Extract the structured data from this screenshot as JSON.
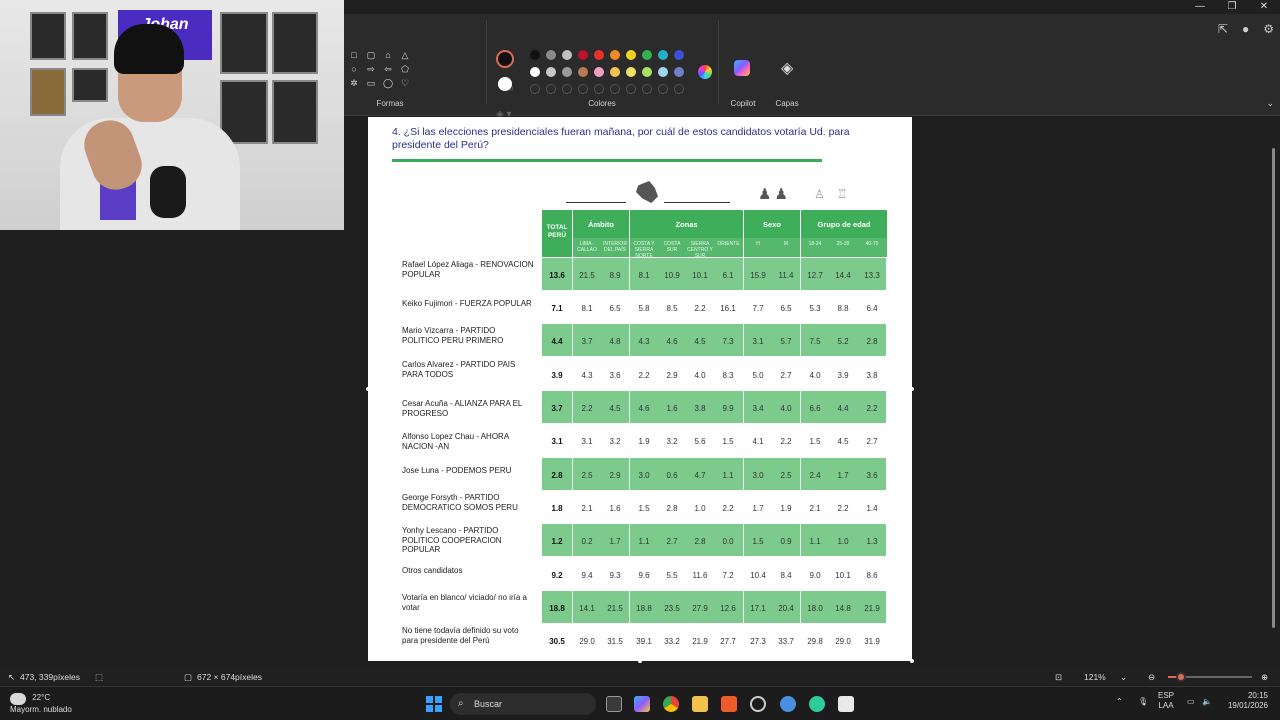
{
  "toolbar": {
    "formas_label": "Formas",
    "colores_label": "Colores",
    "copilot_label": "Copilot",
    "capas_label": "Capas"
  },
  "colors": {
    "palette_row1": [
      "#111111",
      "#8a8a8a",
      "#c0c0c0",
      "#c0102a",
      "#e8312a",
      "#f08a24",
      "#f4d21e",
      "#2fb34a",
      "#22b0c8",
      "#3b4fd8",
      "#9a3fc8"
    ],
    "palette_row2": [
      "#ffffff",
      "#c8c8c8",
      "#9a9a9a",
      "#b77a57",
      "#f3a0c0",
      "#f6c24a",
      "#f0e060",
      "#a8e060",
      "#9ad8f0",
      "#7080c8",
      "#c0a0e0"
    ],
    "accent_green": "#3fae5b",
    "band_green": "#7ccb8c"
  },
  "webcam": {
    "logo_text": "Johan"
  },
  "document": {
    "question": "4. ¿Si las elecciones presidenciales fueran mañana, por cuál de estos candidatos votaría Ud. para presidente del Perú?",
    "headers": {
      "total": "TOTAL PERÚ",
      "ambito": "Ámbito",
      "zonas": "Zonas",
      "sexo": "Sexo",
      "grupo": "Grupo de edad"
    },
    "subheaders": [
      "LIMA - CALLAO",
      "INTERIOR DEL PAÍS",
      "COSTA Y SIERRA NORTE",
      "COSTA SUR",
      "SIERRA CENTRO Y SUR",
      "ORIENTE",
      "H",
      "M",
      "18-24",
      "25-39",
      "40-70"
    ],
    "rows": [
      {
        "label": "Rafael López Aliaga - RENOVACION POPULAR",
        "total": "13.6",
        "values": [
          "21.5",
          "8.9",
          "8.1",
          "10.9",
          "10.1",
          "6.1",
          "15.9",
          "11.4",
          "12.7",
          "14.4",
          "13.3"
        ]
      },
      {
        "label": "Keiko Fujimori - FUERZA POPULAR",
        "total": "7.1",
        "values": [
          "8.1",
          "6.5",
          "5.8",
          "8.5",
          "2.2",
          "16.1",
          "7.7",
          "6.5",
          "5.3",
          "8.8",
          "6.4"
        ]
      },
      {
        "label": "Mario Vizcarra - PARTIDO POLITICO PERU PRIMERO",
        "total": "4.4",
        "values": [
          "3.7",
          "4.8",
          "4.3",
          "4.6",
          "4.5",
          "7.3",
          "3.1",
          "5.7",
          "7.5",
          "5.2",
          "2.8"
        ]
      },
      {
        "label": "Carlos Alvarez - PARTIDO PAIS PARA TODOS",
        "total": "3.9",
        "values": [
          "4.3",
          "3.6",
          "2.2",
          "2.9",
          "4.0",
          "8.3",
          "5.0",
          "2.7",
          "4.0",
          "3.9",
          "3.8"
        ]
      },
      {
        "label": "Cesar Acuña - ALIANZA PARA EL PROGRESO",
        "total": "3.7",
        "values": [
          "2.2",
          "4.5",
          "4.6",
          "1.6",
          "3.8",
          "9.9",
          "3.4",
          "4.0",
          "6.6",
          "4.4",
          "2.2"
        ]
      },
      {
        "label": "Alfonso Lopez Chau - AHORA NACION -AN",
        "total": "3.1",
        "values": [
          "3.1",
          "3.2",
          "1.9",
          "3.2",
          "5.6",
          "1.5",
          "4.1",
          "2.2",
          "1.5",
          "4.5",
          "2.7"
        ]
      },
      {
        "label": "Jose Luna - PODEMOS PERU",
        "total": "2.8",
        "values": [
          "2.5",
          "2.9",
          "3.0",
          "0.6",
          "4.7",
          "1.1",
          "3.0",
          "2.5",
          "2.4",
          "1.7",
          "3.6"
        ]
      },
      {
        "label": "George Forsyth - PARTIDO DEMOCRATICO SOMOS PERU",
        "total": "1.8",
        "values": [
          "2.1",
          "1.6",
          "1.5",
          "2.8",
          "1.0",
          "2.2",
          "1.7",
          "1.9",
          "2.1",
          "2.2",
          "1.4"
        ]
      },
      {
        "label": "Yonhy Lescano - PARTIDO POLITICO COOPERACION POPULAR",
        "total": "1.2",
        "values": [
          "0.2",
          "1.7",
          "1.1",
          "2.7",
          "2.8",
          "0.0",
          "1.5",
          "0.9",
          "1.1",
          "1.0",
          "1.3"
        ]
      },
      {
        "label": "Otros candidatos",
        "total": "9.2",
        "values": [
          "9.4",
          "9.3",
          "9.6",
          "5.5",
          "11.6",
          "7.2",
          "10.4",
          "8.4",
          "9.0",
          "10.1",
          "8.6"
        ]
      },
      {
        "label": "Votaría en blanco/ viciado/ no iría a votar",
        "total": "18.8",
        "values": [
          "14.1",
          "21.5",
          "18.8",
          "23.5",
          "27.9",
          "12.6",
          "17.1",
          "20.4",
          "18.0",
          "14.8",
          "21.9"
        ]
      },
      {
        "label": "No tiene todavía definido su voto para presidente del Perú",
        "total": "30.5",
        "values": [
          "29.0",
          "31.5",
          "39.1",
          "33.2",
          "21.9",
          "27.7",
          "27.3",
          "33.7",
          "29.8",
          "29.0",
          "31.9"
        ]
      }
    ]
  },
  "statusbar": {
    "cursor_pos": "473, 339píxeles",
    "selection_size": "672 × 674píxeles",
    "zoom": "121%",
    "zoom_fraction": 0.15
  },
  "taskbar": {
    "temperature": "22°C",
    "weather": "Mayorm. nublado",
    "search_placeholder": "Buscar",
    "lang_top": "ESP",
    "lang_bottom": "LAA",
    "time": "20:15",
    "date": "19/01/2026"
  }
}
